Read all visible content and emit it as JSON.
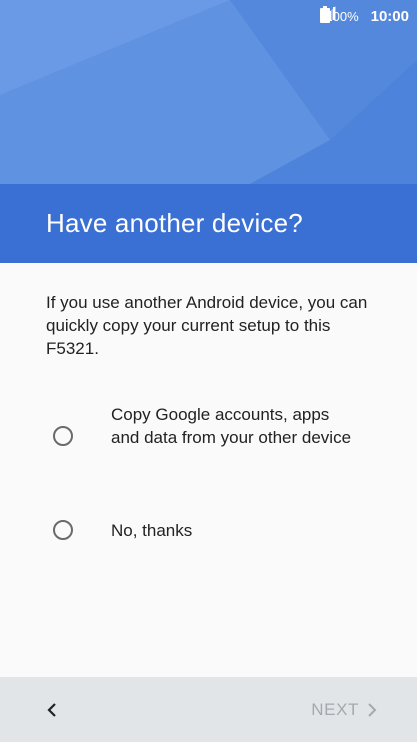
{
  "status_bar": {
    "signal_icon": "signal-icon",
    "battery_percent": "100%",
    "battery_icon": "battery-icon",
    "time": "10:00"
  },
  "header": {
    "title": "Have another device?"
  },
  "main": {
    "intro": "If you use another Android device, you can quickly copy your current setup to this F5321.",
    "options": [
      {
        "label": "Copy Google accounts, apps and data from your other device",
        "selected": false
      },
      {
        "label": "No, thanks",
        "selected": false
      }
    ]
  },
  "footer": {
    "back_icon": "chevron-left-icon",
    "next_label": "NEXT",
    "next_icon": "chevron-right-icon",
    "next_enabled": false
  },
  "colors": {
    "hero": "#5d8fe0",
    "title_band": "#3a70d4",
    "footer": "#e2e5e8",
    "disabled_text": "#a5a9ad"
  }
}
